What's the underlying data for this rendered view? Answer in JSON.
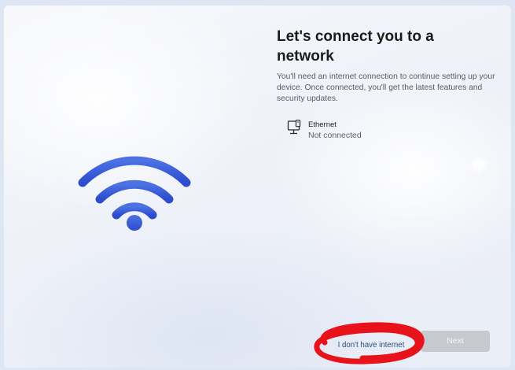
{
  "page": {
    "title": "Let's connect you to a network",
    "description": "You'll need an internet connection to continue setting up your device. Once connected, you'll get the latest features and security updates."
  },
  "network_list": [
    {
      "name": "Ethernet",
      "status": "Not connected",
      "icon": "ethernet-icon"
    }
  ],
  "hero_icon": "wifi-icon",
  "footer": {
    "no_internet_label": "I don't have internet",
    "next_label": "Next"
  },
  "colors": {
    "wifi_gradient_top": "#4a6fe0",
    "wifi_gradient_bottom": "#2f4fcf",
    "link": "#274f7f",
    "next_disabled_bg": "#c7c9cf",
    "annotation": "#e8121b"
  }
}
